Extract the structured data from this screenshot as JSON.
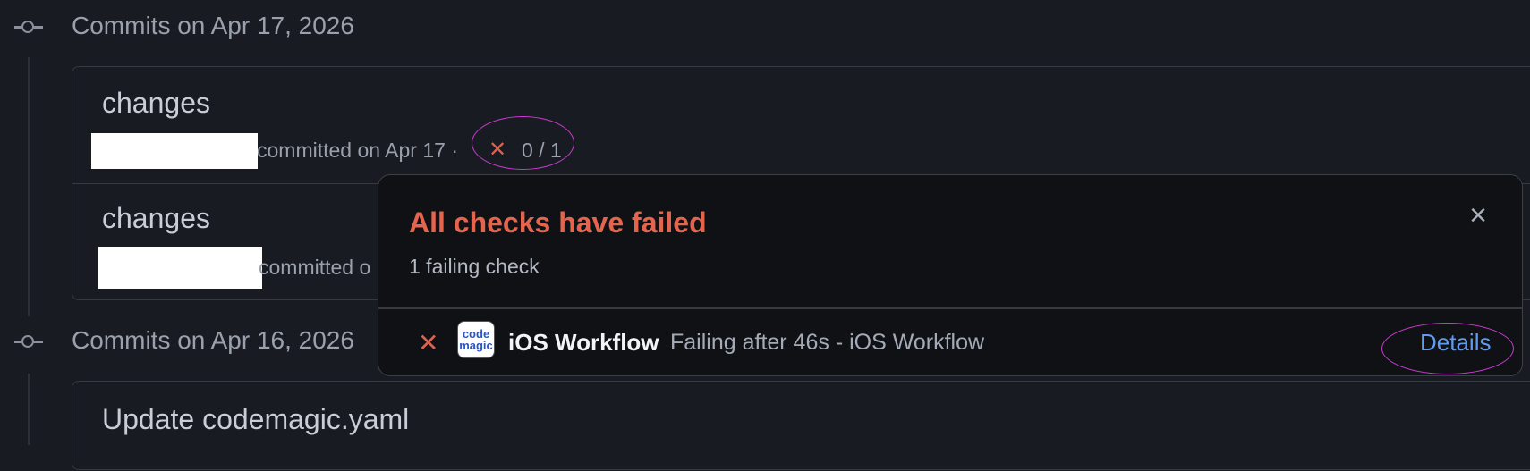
{
  "timeline": {
    "groups": [
      {
        "date_heading": "Commits on Apr 17, 2026",
        "commits": [
          {
            "title": "changes",
            "meta_text": "committed on Apr 17 ·",
            "check_status": "0 / 1"
          },
          {
            "title": "changes",
            "meta_text": "committed o"
          }
        ]
      },
      {
        "date_heading": "Commits on Apr 16, 2026",
        "commits": [
          {
            "title": "Update codemagic.yaml"
          }
        ]
      }
    ]
  },
  "popover": {
    "title": "All checks have failed",
    "subtitle": "1 failing check",
    "close_icon": "close-icon",
    "checks": [
      {
        "logo_text": "code magic",
        "name": "iOS Workflow",
        "description": "Failing after 46s - iOS Workflow",
        "details_label": "Details"
      }
    ]
  },
  "colors": {
    "background": "#181b21",
    "popover_bg": "#0f1115",
    "fail_red": "#e5644d",
    "link_blue": "#5f9bf0",
    "annotation_magenta": "#c93bcf"
  }
}
